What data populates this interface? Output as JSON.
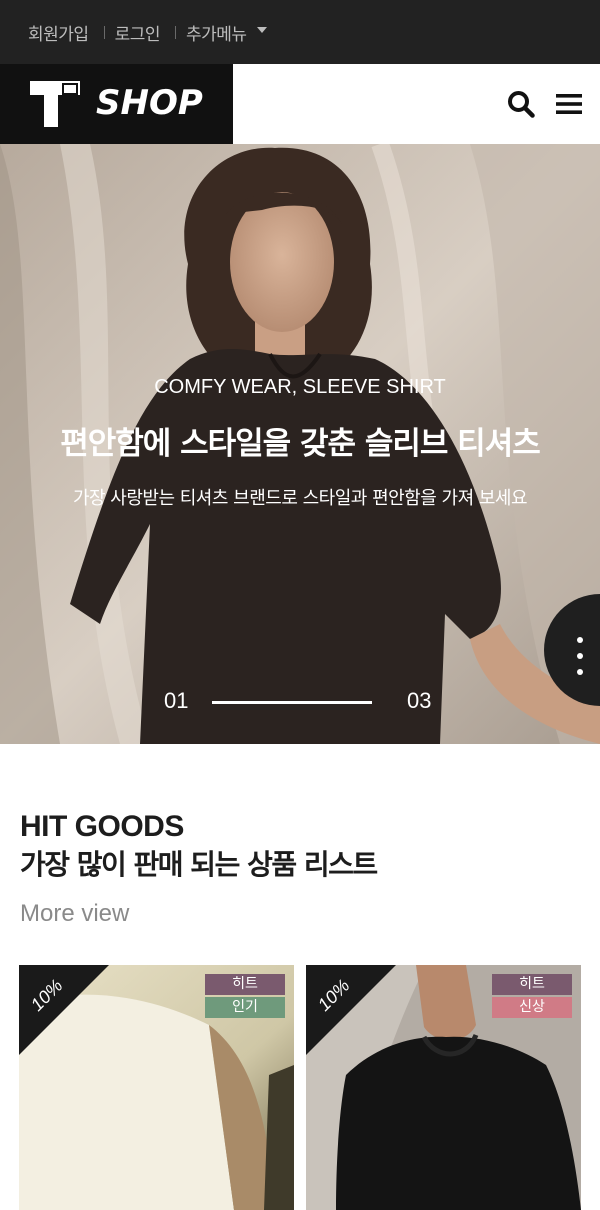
{
  "topbar": {
    "signup": "회원가입",
    "login": "로그인",
    "more_menu": "추가메뉴"
  },
  "header": {
    "logo_text": "SHOP",
    "icons": {
      "search": "search-icon",
      "menu": "hamburger-menu-icon"
    }
  },
  "hero": {
    "subtitle": "COMFY WEAR, SLEEVE SHIRT",
    "title": "편안함에 스타일을 갖춘 슬리브 티셔츠",
    "description": "가장 사랑받는 티셔츠 브랜드로 스타일과 편안함을 가져 보세요",
    "current_slide": "01",
    "total_slides": "03",
    "progress": 1.0
  },
  "section": {
    "title": "HIT GOODS",
    "subtitle": "가장 많이 판매 되는 상품 리스트",
    "more_link": "More view"
  },
  "products": [
    {
      "discount": "10%",
      "tags": [
        {
          "label": "히트",
          "color": "#7a5a6e"
        },
        {
          "label": "인기",
          "color": "#6f9a7c"
        }
      ]
    },
    {
      "discount": "10%",
      "tags": [
        {
          "label": "히트",
          "color": "#7a5a6e"
        },
        {
          "label": "신상",
          "color": "#d07b86"
        }
      ]
    }
  ],
  "colors": {
    "topbar_bg": "#222222",
    "logo_bg": "#111111",
    "accent_dark": "#1f1f1f"
  }
}
